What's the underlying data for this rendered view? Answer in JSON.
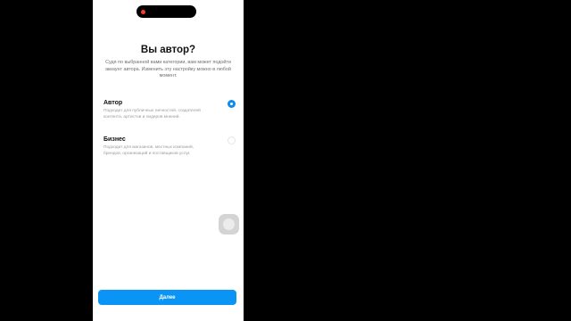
{
  "screen": {
    "title": "Вы автор?",
    "subtitle": "Судя по выбранной вами категории, вам может подойти аккаунт автора. Изменить эту настройку можно в любой момент."
  },
  "options": [
    {
      "label": "Автор",
      "description": "Подходит для публичных личностей, создателей контента, артистов и лидеров мнений.",
      "selected": true
    },
    {
      "label": "Бизнес",
      "description": "Подходит для магазинов, местных компаний, брендов, организаций и поставщиков услуг.",
      "selected": false
    }
  ],
  "next_button": {
    "label": "Далее"
  },
  "colors": {
    "accent": "#0a95f6",
    "radio_selected": "#0a8cf0",
    "background": "#ffffff",
    "letterbox": "#000000",
    "recording_indicator": "#ff3b30"
  },
  "icons": {
    "recording_indicator": "recording-dot-icon",
    "assistive_touch": "assistive-touch-icon"
  }
}
